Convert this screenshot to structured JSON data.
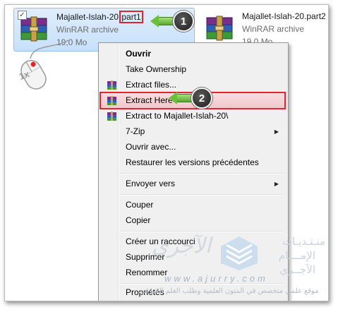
{
  "files": [
    {
      "name_prefix": "Majallet-Islah-20.",
      "name_highlight": "part1",
      "type": "WinRAR archive",
      "size": "19,0 Mo",
      "selected": true
    },
    {
      "name": "Majallet-Islah-20.part2",
      "type": "WinRAR archive",
      "size": "19,0 Mo",
      "selected": false
    }
  ],
  "callouts": {
    "step1": "1",
    "step2": "2"
  },
  "mouse": {
    "click_label": "1x"
  },
  "menu": {
    "items": [
      {
        "label": "Ouvrir",
        "bold": true
      },
      {
        "label": "Take Ownership"
      },
      {
        "label": "Extract files...",
        "icon": "winrar-icon"
      },
      {
        "label": "Extract Here",
        "icon": "winrar-icon",
        "hover": true
      },
      {
        "label": "Extract to Majallet-Islah-20\\",
        "icon": "winrar-icon"
      },
      {
        "label": "7-Zip",
        "submenu": true
      },
      {
        "label": "Ouvrir avec..."
      },
      {
        "label": "Restaurer les versions précédentes"
      },
      {
        "label": "Envoyer vers",
        "submenu": true
      },
      {
        "label": "Couper"
      },
      {
        "label": "Copier"
      },
      {
        "label": "Créer un raccourci"
      },
      {
        "label": "Supprimer"
      },
      {
        "label": "Renommer"
      },
      {
        "label": "Propriétés"
      }
    ]
  },
  "watermark": {
    "brand": "الآجري",
    "line1": "منـتـديـات",
    "line2": "الإمــــام",
    "line3": "الآجــري",
    "url": "www.ajurry.com",
    "tagline": "موقع علمي متخصص في المتون العلمية وطلب العلم الشرعي"
  },
  "colors": {
    "highlight_red": "#e2262e",
    "selection_blue": "#c7e0fa",
    "arrow_green": "#6cbf3a"
  }
}
